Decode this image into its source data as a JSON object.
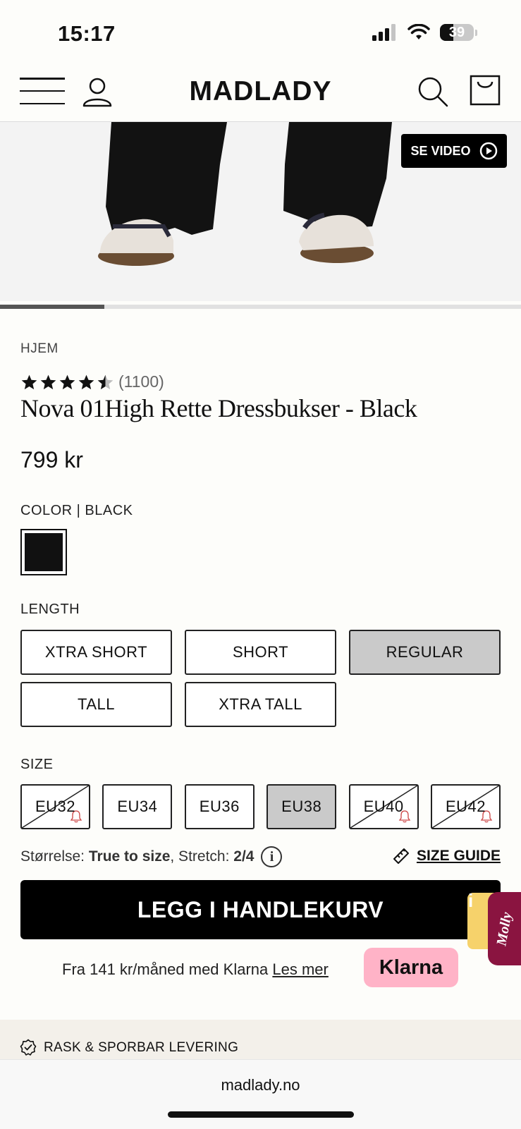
{
  "status_bar": {
    "time": "15:17",
    "battery": "39"
  },
  "header": {
    "logo": "MADLADY"
  },
  "hero": {
    "video_button": "SE VIDEO",
    "gallery_progress": 0.2
  },
  "breadcrumb": "HJEM",
  "product": {
    "rating": 4.5,
    "review_count": "(1100)",
    "title": "Nova 01High Rette Dressbukser - Black",
    "price": "799 kr"
  },
  "color": {
    "label": "COLOR | BLACK",
    "swatch_color": "#111111"
  },
  "length": {
    "label": "LENGTH",
    "options": [
      {
        "label": "XTRA SHORT",
        "selected": false
      },
      {
        "label": "SHORT",
        "selected": false
      },
      {
        "label": "REGULAR",
        "selected": true
      },
      {
        "label": "TALL",
        "selected": false
      },
      {
        "label": "XTRA TALL",
        "selected": false
      }
    ]
  },
  "size": {
    "label": "SIZE",
    "options": [
      {
        "label": "EU32",
        "selected": false,
        "sold_out": true
      },
      {
        "label": "EU34",
        "selected": false,
        "sold_out": false
      },
      {
        "label": "EU36",
        "selected": false,
        "sold_out": false
      },
      {
        "label": "EU38",
        "selected": true,
        "sold_out": false
      },
      {
        "label": "EU40",
        "selected": false,
        "sold_out": true
      },
      {
        "label": "EU42",
        "selected": false,
        "sold_out": true
      }
    ]
  },
  "fit": {
    "size_label": "Størrelse: ",
    "size_value": "True to size",
    "stretch_label": ", Stretch: ",
    "stretch_value": "2/4",
    "size_guide": "SIZE GUIDE"
  },
  "cart_button": "LEGG I HANDLEKURV",
  "chat": {
    "letter": "i",
    "molly": "Molly"
  },
  "klarna": {
    "text": "Fra 141 kr/måned med Klarna ",
    "link": "Les mer",
    "badge": "Klarna"
  },
  "delivery": "RASK & SPORBAR LEVERING",
  "browser": {
    "url": "madlady.no"
  },
  "colors": {
    "selected_bg": "#cacaca",
    "klarna_pink": "#ffb3c7",
    "molly_bg": "#8a1440"
  }
}
